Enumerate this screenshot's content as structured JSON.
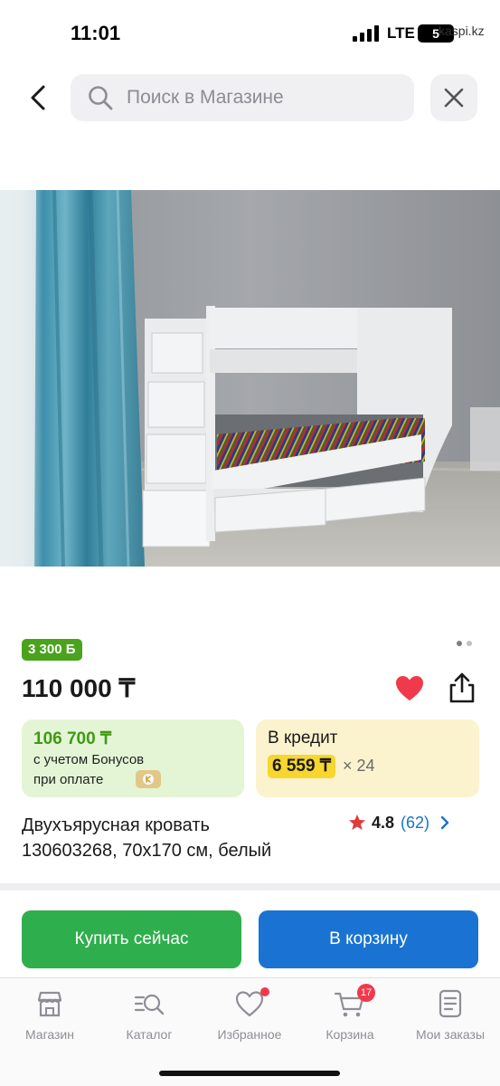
{
  "status_bar": {
    "time": "11:01",
    "network": "LTE",
    "battery": "5",
    "watermark": "kaspi.kz"
  },
  "search": {
    "placeholder": "Поиск в Магазине"
  },
  "product": {
    "bonus_badge": "3 300 Б",
    "price": "110 000 ₸",
    "bonus_card": {
      "price": "106 700 ₸",
      "line1": "с учетом Бонусов",
      "line2": "при оплате"
    },
    "credit_card": {
      "title": "В кредит",
      "amount": "6 559 ₸",
      "multiplier": "× 24"
    },
    "title_line1": "Двухъярусная кровать",
    "title_line2": "130603268, 70x170 см, белый",
    "rating": {
      "value": "4.8",
      "count": "(62)"
    },
    "favorite": true,
    "image_count": 2,
    "active_image": 0
  },
  "actions": {
    "buy_now": "Купить сейчас",
    "add_to_cart": "В корзину"
  },
  "tab_bar": {
    "items": [
      {
        "label": "Магазин",
        "icon": "shop-icon"
      },
      {
        "label": "Каталог",
        "icon": "catalog-search-icon"
      },
      {
        "label": "Избранное",
        "icon": "heart-outline-icon"
      },
      {
        "label": "Корзина",
        "icon": "cart-icon",
        "badge": "17"
      },
      {
        "label": "Мои заказы",
        "icon": "orders-icon"
      }
    ]
  },
  "colors": {
    "bonus_green": "#4aa31c",
    "favorite_red": "#f0394a",
    "buy_green": "#2fae4d",
    "cart_blue": "#1a73d2",
    "credit_yellow": "#f6d62f",
    "link_blue": "#1a73c8"
  }
}
